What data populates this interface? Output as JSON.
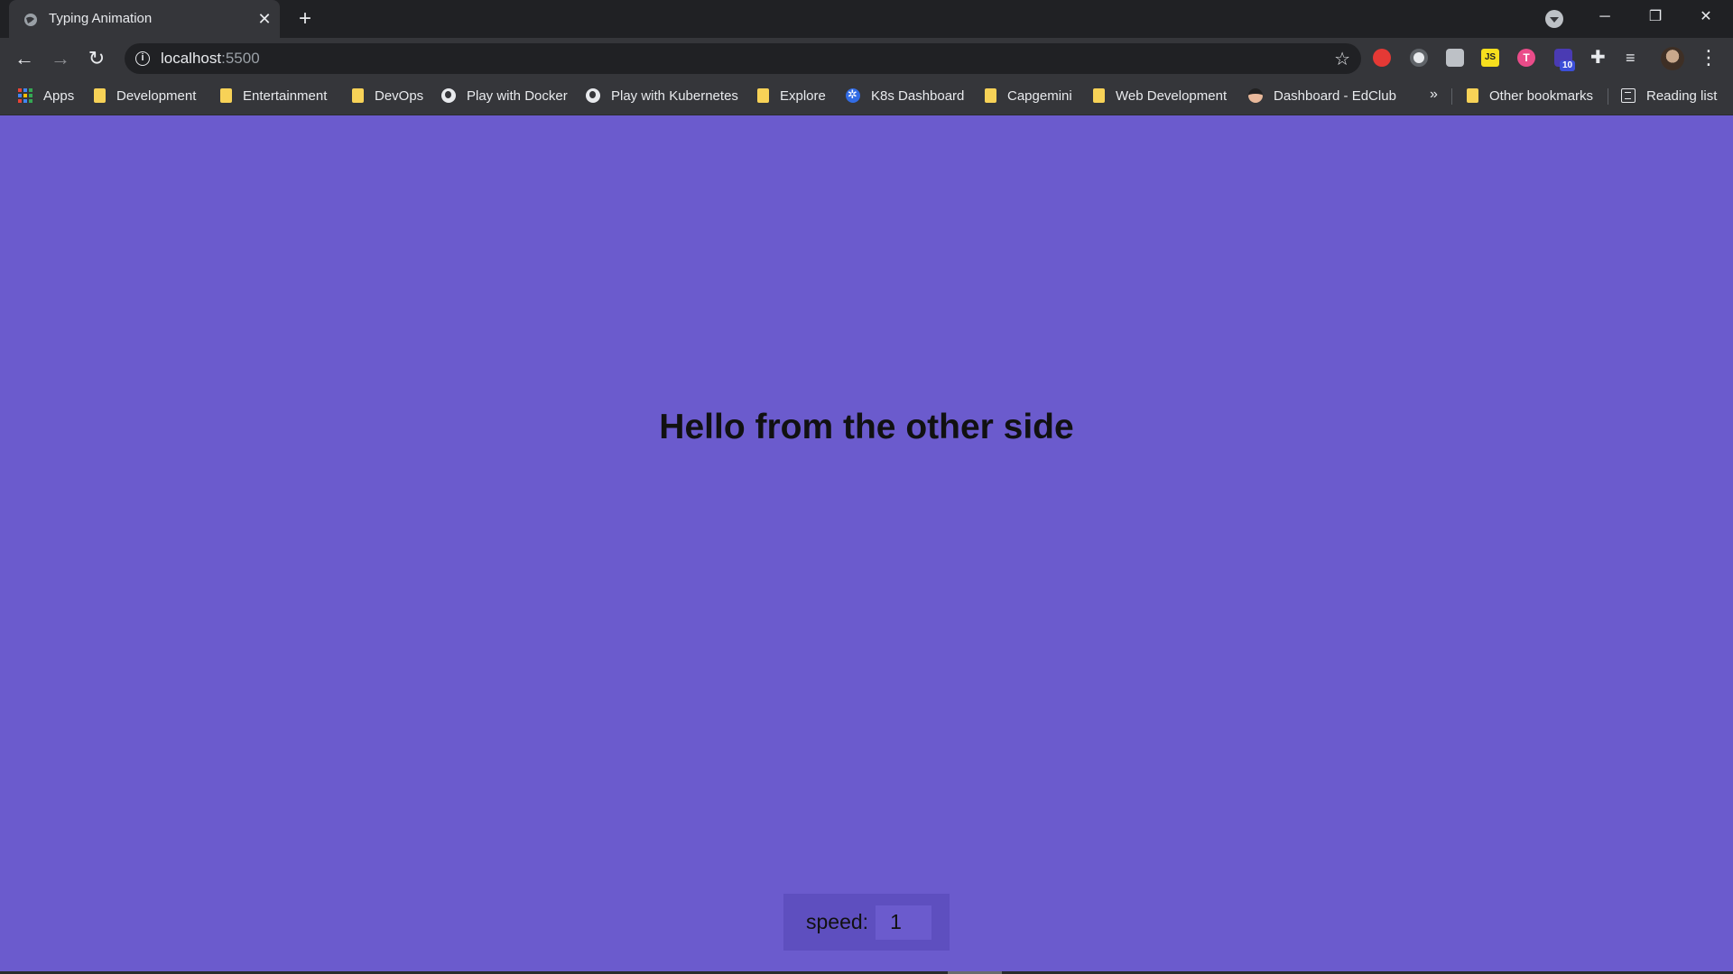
{
  "tab": {
    "title": "Typing Animation",
    "close": "✕",
    "new_tab": "+"
  },
  "window": {
    "minimize": "─",
    "maximize": "❐",
    "close": "✕"
  },
  "toolbar": {
    "back": "←",
    "forward": "→",
    "reload": "↻",
    "url_host": "localhost",
    "url_port": ":5500",
    "info": "i",
    "star": "☆",
    "ext_js": "JS",
    "ext_t": "T",
    "ext_badge": "10",
    "puzzle": "✚",
    "media": "≡",
    "menu": "⋮"
  },
  "bookmarks": {
    "items": [
      {
        "label": "Apps",
        "icon": "apps-icon"
      },
      {
        "label": "Development",
        "icon": "folder-icon"
      },
      {
        "label": "Entertainment",
        "icon": "folder-icon"
      },
      {
        "label": "DevOps",
        "icon": "folder-icon"
      },
      {
        "label": "Play with Docker",
        "icon": "globe-icon"
      },
      {
        "label": "Play with Kubernetes",
        "icon": "globe-icon"
      },
      {
        "label": "Explore",
        "icon": "folder-icon"
      },
      {
        "label": "K8s Dashboard",
        "icon": "kubernetes-icon"
      },
      {
        "label": "Capgemini",
        "icon": "folder-icon"
      },
      {
        "label": "Web Development",
        "icon": "folder-icon"
      },
      {
        "label": "Dashboard - EdClub",
        "icon": "edclub-icon"
      }
    ],
    "overflow": "»",
    "other": "Other bookmarks",
    "reading_list": "Reading list"
  },
  "page": {
    "headline": "Hello from the other side",
    "speed_label": "speed:",
    "speed_value": "1",
    "background_color": "#6b5bcd"
  }
}
